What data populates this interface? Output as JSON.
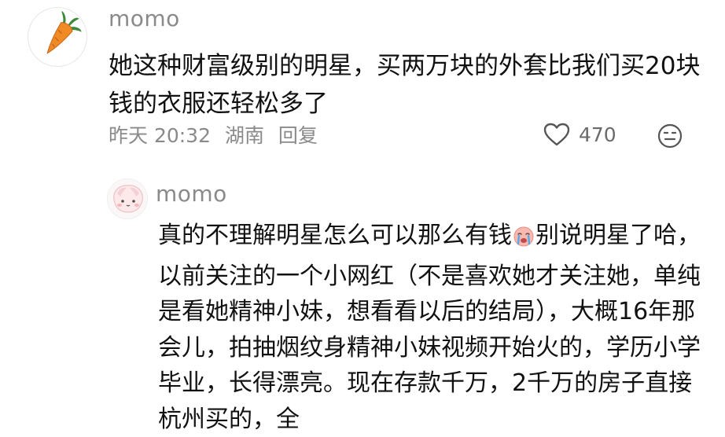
{
  "comment": {
    "username": "momo",
    "text": "她这种财富级别的明星，买两万块的外套比我们买20块钱的衣服还轻松多了",
    "meta": {
      "time": "昨天 20:32",
      "location": "湖南",
      "reply_label": "回复"
    },
    "like_count": "470",
    "avatar_icon": "carrot-icon",
    "like_icon": "heart-outline-icon",
    "more_icon": "emoji-face-icon"
  },
  "reply": {
    "username": "momo",
    "text_part1": "真的不理解明星怎么可以那么有钱",
    "emoji": "crying-face-emoji",
    "text_part2": "别说明星了哈，以前关注的一个小网红（不是喜欢她才关注她，单纯是看她精神小妹，想看看以后的结局），大概16年那会儿，拍抽烟纹身精神小妹视频开始火的，学历小学毕业，长得漂亮。现在存款千万，2千万的房子直接杭州买的，全",
    "avatar_icon": "cute-character-avatar"
  },
  "colors": {
    "text": "#111111",
    "muted": "#8a8a8a",
    "carrot": "#f08a24",
    "leaf": "#3f8a3a"
  }
}
